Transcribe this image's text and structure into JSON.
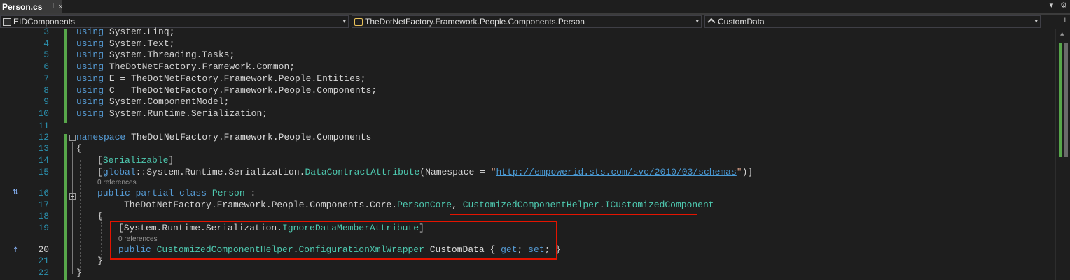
{
  "tab": {
    "title": "Person.cs",
    "pin_glyph": "⊣",
    "close_glyph": "×"
  },
  "top_right": {
    "dropdown_glyph": "▾",
    "settings_glyph": "⚙"
  },
  "nav": {
    "project": "EIDComponents",
    "type": "TheDotNetFactory.Framework.People.Components.Person",
    "member": "CustomData",
    "dropdown_glyph": "▾",
    "add_glyph": "+"
  },
  "code": {
    "l3": {
      "num": "3",
      "kw": "using",
      "rest": " System.Linq;"
    },
    "l4": {
      "num": "4",
      "kw": "using",
      "rest": " System.Text;"
    },
    "l5": {
      "num": "5",
      "kw": "using",
      "rest": " System.Threading.Tasks;"
    },
    "l6": {
      "num": "6",
      "kw": "using",
      "rest": " TheDotNetFactory.Framework.Common;"
    },
    "l7": {
      "num": "7",
      "kw": "using",
      "rest": " E = TheDotNetFactory.Framework.People.Entities;"
    },
    "l8": {
      "num": "8",
      "kw": "using",
      "rest": " C = TheDotNetFactory.Framework.People.Components;"
    },
    "l9": {
      "num": "9",
      "kw": "using",
      "rest": " System.ComponentModel;"
    },
    "l10": {
      "num": "10",
      "kw": "using",
      "rest": " System.Runtime.Serialization;"
    },
    "l11": {
      "num": "11"
    },
    "l12": {
      "num": "12",
      "kw": "namespace",
      "rest": " TheDotNetFactory.Framework.People.Components"
    },
    "l13": {
      "num": "13",
      "text": "{"
    },
    "l14": {
      "num": "14",
      "open": "[",
      "type": "Serializable",
      "close": "]"
    },
    "l15": {
      "num": "15",
      "open": "[",
      "kw": "global",
      "a": "::System.Runtime.Serialization.",
      "type": "DataContractAttribute",
      "b": "(Namespace = ",
      "q1": "\"",
      "link": "http://empowerid.sts.com/svc/2010/03/schemas",
      "q2": "\"",
      "c": ")]"
    },
    "ref1": "0 references",
    "l16": {
      "num": "16",
      "kw": "public partial class",
      "sp": " ",
      "name": "Person",
      "rest": " :"
    },
    "l17": {
      "num": "17",
      "a": "TheDotNetFactory.Framework.People.Components.Core.",
      "t1": "PersonCore",
      "b": ", ",
      "t2": "CustomizedComponentHelper",
      "dot": ".",
      "t3": "ICustomizedComponent"
    },
    "l18": {
      "num": "18",
      "text": "{"
    },
    "l19": {
      "num": "19",
      "open": "[System.Runtime.Serialization.",
      "type": "IgnoreDataMemberAttribute",
      "close": "]"
    },
    "ref2": "0 references",
    "l20": {
      "num": "20",
      "kw": "public",
      "sp": " ",
      "t1": "CustomizedComponentHelper",
      "dot": ".",
      "t2": "ConfigurationXmlWrapper",
      "name": " CustomData { ",
      "get": "get",
      "semi1": "; ",
      "set": "set",
      "end": "; }"
    },
    "l21": {
      "num": "21",
      "text": "}"
    },
    "l22": {
      "num": "22",
      "text": "}"
    }
  },
  "gutter": {
    "class_icon": "⇅",
    "member_icon": "↑"
  },
  "scrollbar": {
    "up_glyph": "▲"
  },
  "colors": {
    "keyword": "#569cd6",
    "type": "#4ec9b0",
    "string": "#d69d85",
    "line_number": "#2b91af",
    "change_bar": "#57a64a",
    "highlight": "#e51400"
  }
}
